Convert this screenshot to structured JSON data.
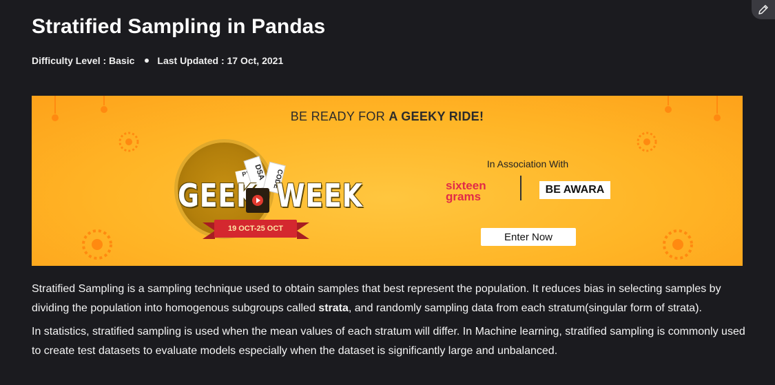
{
  "article": {
    "title": "Stratified Sampling in Pandas",
    "difficulty": "Difficulty Level : Basic",
    "updated": "Last Updated : 17 Oct, 2021"
  },
  "banner": {
    "headline_pre": "BE READY FOR ",
    "headline_bold": "A GEEKY RIDE!",
    "event_word_1": "GEEK",
    "event_word_2": "WEEK",
    "dates": "19 OCT-25 OCT",
    "tickets": [
      "DSA",
      "CODE",
      "PY"
    ],
    "association": "In Association With",
    "sponsor_1": "sixteen grams",
    "sponsor_2": "BE AWARA",
    "cta": "Enter Now",
    "colors": {
      "background": "#ffb526",
      "ribbon": "#d4282f",
      "sponsor_1": "#e12a48"
    }
  },
  "body": {
    "p1_pre": "Stratified Sampling is a sampling technique used to obtain samples that best represent the population. It reduces bias in selecting samples by dividing the population into homogenous subgroups called ",
    "p1_bold": "strata",
    "p1_post": ", and randomly sampling data from each stratum(singular form of strata).",
    "p2": "In statistics, stratified sampling is used when the mean values of each stratum will differ. In Machine learning, stratified sampling is commonly used to create test datasets to evaluate models especially when the dataset is significantly large and unbalanced."
  },
  "toolbar": {
    "edit_icon": "pencil-icon"
  }
}
